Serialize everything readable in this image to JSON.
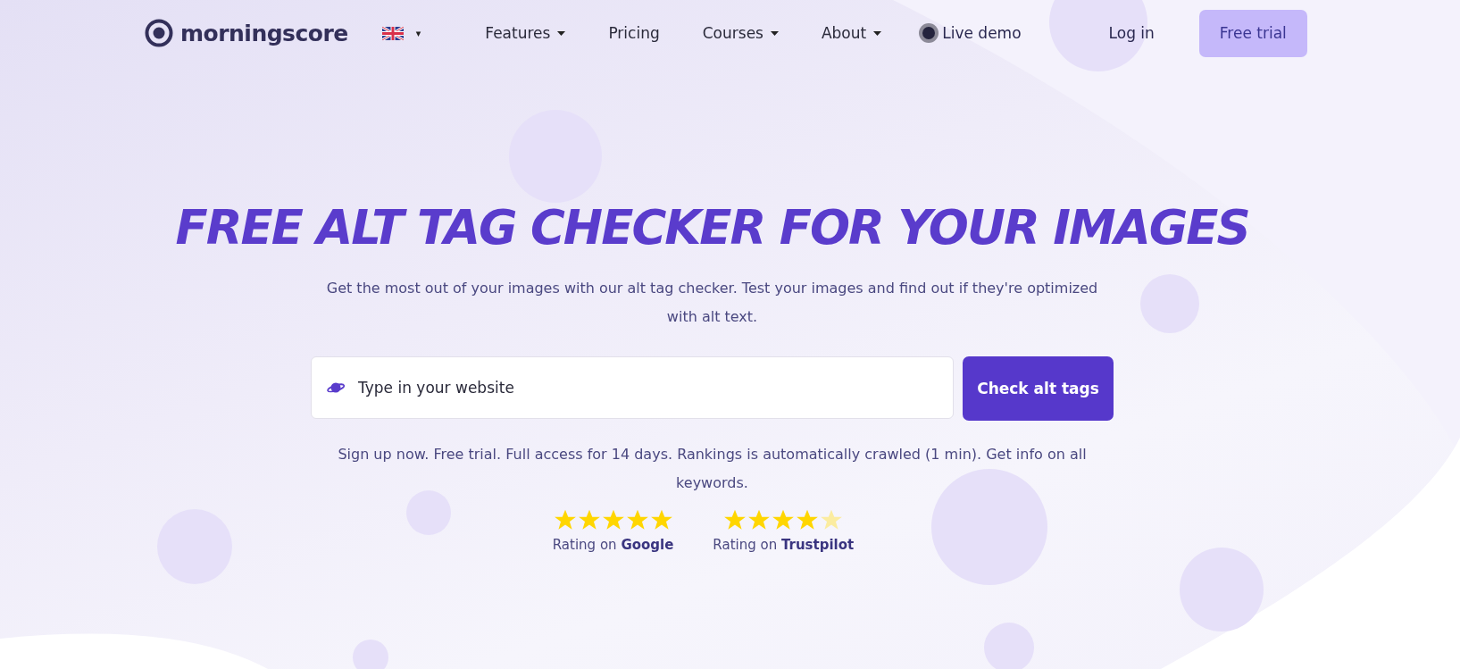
{
  "nav": {
    "logo": "morningscore",
    "language_caret": "▾",
    "links": [
      {
        "label": "Features",
        "dropdown": true
      },
      {
        "label": "Pricing",
        "dropdown": false
      },
      {
        "label": "Courses",
        "dropdown": true
      },
      {
        "label": "About",
        "dropdown": true
      }
    ],
    "live_demo": "Live demo",
    "login": "Log in",
    "cta": "Free trial"
  },
  "hero": {
    "title": "FREE ALT TAG CHECKER FOR YOUR IMAGES",
    "subtitle": "Get the most out of your images with our alt tag checker. Test your images and find out if they're optimized with alt text.",
    "search": {
      "placeholder": "Type in your website"
    },
    "button": "Check alt tags",
    "note": "Sign up now. Free trial. Full access for 14 days. Rankings is automatically crawled (1 min). Get info on all keywords.",
    "ratings": [
      {
        "stars": 5,
        "label": "Rating on **Google**"
      },
      {
        "stars": 4,
        "label": "Rating on **Trustpilot**"
      }
    ]
  }
}
